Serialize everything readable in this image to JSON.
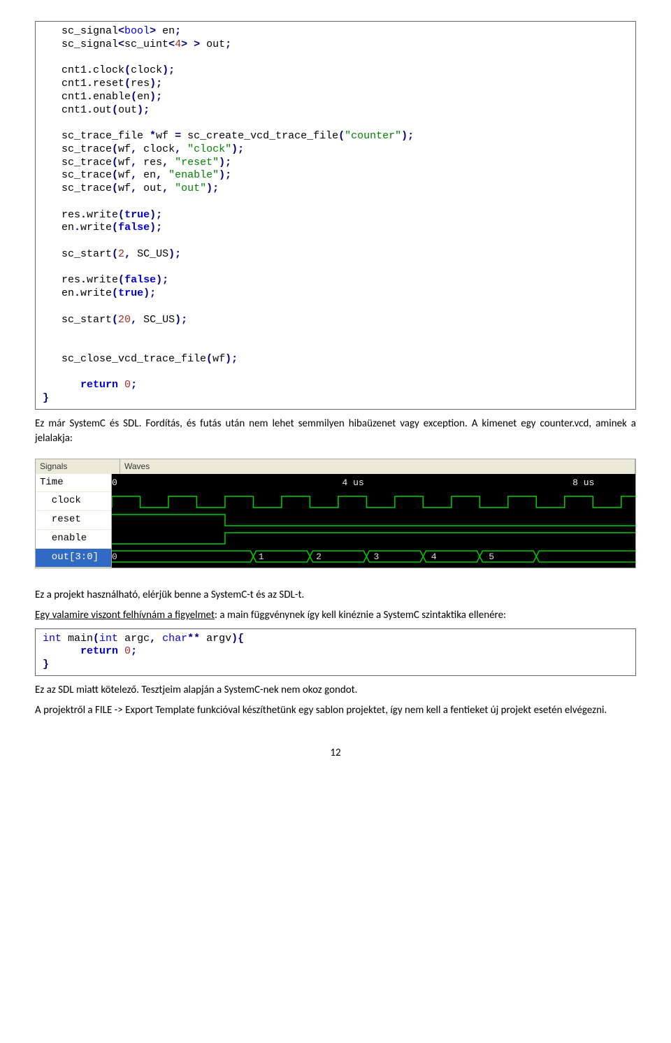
{
  "code1": {
    "lines": [
      [
        {
          "t": "sc_signal",
          "c": ""
        },
        {
          "t": "<",
          "c": "c-navy"
        },
        {
          "t": "bool",
          "c": "c-blue"
        },
        {
          "t": ">",
          "c": "c-navy"
        },
        {
          "t": " en",
          "c": ""
        },
        {
          "t": ";",
          "c": "c-navy"
        }
      ],
      [
        {
          "t": "sc_signal",
          "c": ""
        },
        {
          "t": "<",
          "c": "c-navy"
        },
        {
          "t": "sc_uint",
          "c": ""
        },
        {
          "t": "<",
          "c": "c-navy"
        },
        {
          "t": "4",
          "c": "c-brown"
        },
        {
          "t": ">",
          "c": "c-navy"
        },
        {
          "t": " ",
          "c": ""
        },
        {
          "t": ">",
          "c": "c-navy"
        },
        {
          "t": " out",
          "c": ""
        },
        {
          "t": ";",
          "c": "c-navy"
        }
      ],
      [],
      [
        {
          "t": "cnt1",
          "c": ""
        },
        {
          "t": ".",
          "c": "c-navy"
        },
        {
          "t": "clock",
          "c": ""
        },
        {
          "t": "(",
          "c": "c-navy"
        },
        {
          "t": "clock",
          "c": ""
        },
        {
          "t": ");",
          "c": "c-navy"
        }
      ],
      [
        {
          "t": "cnt1",
          "c": ""
        },
        {
          "t": ".",
          "c": "c-navy"
        },
        {
          "t": "reset",
          "c": ""
        },
        {
          "t": "(",
          "c": "c-navy"
        },
        {
          "t": "res",
          "c": ""
        },
        {
          "t": ");",
          "c": "c-navy"
        }
      ],
      [
        {
          "t": "cnt1",
          "c": ""
        },
        {
          "t": ".",
          "c": "c-navy"
        },
        {
          "t": "enable",
          "c": ""
        },
        {
          "t": "(",
          "c": "c-navy"
        },
        {
          "t": "en",
          "c": ""
        },
        {
          "t": ");",
          "c": "c-navy"
        }
      ],
      [
        {
          "t": "cnt1",
          "c": ""
        },
        {
          "t": ".",
          "c": "c-navy"
        },
        {
          "t": "out",
          "c": ""
        },
        {
          "t": "(",
          "c": "c-navy"
        },
        {
          "t": "out",
          "c": ""
        },
        {
          "t": ");",
          "c": "c-navy"
        }
      ],
      [],
      [
        {
          "t": "sc_trace_file ",
          "c": ""
        },
        {
          "t": "*",
          "c": "c-navy"
        },
        {
          "t": "wf ",
          "c": ""
        },
        {
          "t": "=",
          "c": "c-navy"
        },
        {
          "t": " sc_create_vcd_trace_file",
          "c": ""
        },
        {
          "t": "(",
          "c": "c-navy"
        },
        {
          "t": "\"counter\"",
          "c": "c-green"
        },
        {
          "t": ");",
          "c": "c-navy"
        }
      ],
      [
        {
          "t": "sc_trace",
          "c": ""
        },
        {
          "t": "(",
          "c": "c-navy"
        },
        {
          "t": "wf",
          "c": ""
        },
        {
          "t": ",",
          "c": "c-navy"
        },
        {
          "t": " clock",
          "c": ""
        },
        {
          "t": ",",
          "c": "c-navy"
        },
        {
          "t": " ",
          "c": ""
        },
        {
          "t": "\"clock\"",
          "c": "c-green"
        },
        {
          "t": ");",
          "c": "c-navy"
        }
      ],
      [
        {
          "t": "sc_trace",
          "c": ""
        },
        {
          "t": "(",
          "c": "c-navy"
        },
        {
          "t": "wf",
          "c": ""
        },
        {
          "t": ",",
          "c": "c-navy"
        },
        {
          "t": " res",
          "c": ""
        },
        {
          "t": ",",
          "c": "c-navy"
        },
        {
          "t": " ",
          "c": ""
        },
        {
          "t": "\"reset\"",
          "c": "c-green"
        },
        {
          "t": ");",
          "c": "c-navy"
        }
      ],
      [
        {
          "t": "sc_trace",
          "c": ""
        },
        {
          "t": "(",
          "c": "c-navy"
        },
        {
          "t": "wf",
          "c": ""
        },
        {
          "t": ",",
          "c": "c-navy"
        },
        {
          "t": " en",
          "c": ""
        },
        {
          "t": ",",
          "c": "c-navy"
        },
        {
          "t": " ",
          "c": ""
        },
        {
          "t": "\"enable\"",
          "c": "c-green"
        },
        {
          "t": ");",
          "c": "c-navy"
        }
      ],
      [
        {
          "t": "sc_trace",
          "c": ""
        },
        {
          "t": "(",
          "c": "c-navy"
        },
        {
          "t": "wf",
          "c": ""
        },
        {
          "t": ",",
          "c": "c-navy"
        },
        {
          "t": " out",
          "c": ""
        },
        {
          "t": ",",
          "c": "c-navy"
        },
        {
          "t": " ",
          "c": ""
        },
        {
          "t": "\"out\"",
          "c": "c-green"
        },
        {
          "t": ");",
          "c": "c-navy"
        }
      ],
      [],
      [
        {
          "t": "res",
          "c": ""
        },
        {
          "t": ".",
          "c": "c-navy"
        },
        {
          "t": "write",
          "c": ""
        },
        {
          "t": "(",
          "c": "c-navy"
        },
        {
          "t": "true",
          "c": "c-kw"
        },
        {
          "t": ");",
          "c": "c-navy"
        }
      ],
      [
        {
          "t": "en",
          "c": ""
        },
        {
          "t": ".",
          "c": "c-navy"
        },
        {
          "t": "write",
          "c": ""
        },
        {
          "t": "(",
          "c": "c-navy"
        },
        {
          "t": "false",
          "c": "c-kw"
        },
        {
          "t": ");",
          "c": "c-navy"
        }
      ],
      [],
      [
        {
          "t": "sc_start",
          "c": ""
        },
        {
          "t": "(",
          "c": "c-navy"
        },
        {
          "t": "2",
          "c": "c-brown"
        },
        {
          "t": ",",
          "c": "c-navy"
        },
        {
          "t": " SC_US",
          "c": ""
        },
        {
          "t": ");",
          "c": "c-navy"
        }
      ],
      [],
      [
        {
          "t": "res",
          "c": ""
        },
        {
          "t": ".",
          "c": "c-navy"
        },
        {
          "t": "write",
          "c": ""
        },
        {
          "t": "(",
          "c": "c-navy"
        },
        {
          "t": "false",
          "c": "c-kw"
        },
        {
          "t": ");",
          "c": "c-navy"
        }
      ],
      [
        {
          "t": "en",
          "c": ""
        },
        {
          "t": ".",
          "c": "c-navy"
        },
        {
          "t": "write",
          "c": ""
        },
        {
          "t": "(",
          "c": "c-navy"
        },
        {
          "t": "true",
          "c": "c-kw"
        },
        {
          "t": ");",
          "c": "c-navy"
        }
      ],
      [],
      [
        {
          "t": "sc_start",
          "c": ""
        },
        {
          "t": "(",
          "c": "c-navy"
        },
        {
          "t": "20",
          "c": "c-brown"
        },
        {
          "t": ",",
          "c": "c-navy"
        },
        {
          "t": " SC_US",
          "c": ""
        },
        {
          "t": ");",
          "c": "c-navy"
        }
      ],
      [],
      [],
      [
        {
          "t": "sc_close_vcd_trace_file",
          "c": ""
        },
        {
          "t": "(",
          "c": "c-navy"
        },
        {
          "t": "wf",
          "c": ""
        },
        {
          "t": ");",
          "c": "c-navy"
        }
      ],
      [],
      [
        {
          "t": "return",
          "c": "c-kw",
          "indent": 1
        },
        {
          "t": " ",
          "c": ""
        },
        {
          "t": "0",
          "c": "c-brown"
        },
        {
          "t": ";",
          "c": "c-navy"
        }
      ],
      [
        {
          "t": "}",
          "c": "c-navy",
          "noindent": true
        }
      ]
    ]
  },
  "para1": "Ez már SystemC és SDL. Fordítás, és futás után nem lehet semmilyen hibaüzenet vagy exception. A kimenet egy counter.vcd, aminek a jelalakja:",
  "waveform": {
    "header": {
      "signals": "Signals",
      "waves": "Waves"
    },
    "signals": [
      "Time",
      "clock",
      "reset",
      "enable",
      "out[3:0]"
    ],
    "selected": 4,
    "timeTicks": [
      {
        "x": 0,
        "label": "0"
      },
      {
        "x": 44,
        "label": "4 us"
      },
      {
        "x": 88,
        "label": "8 us"
      }
    ],
    "busValues": [
      {
        "x": 0,
        "label": "0"
      },
      {
        "x": 28,
        "label": "1"
      },
      {
        "x": 39,
        "label": "2"
      },
      {
        "x": 50,
        "label": "3"
      },
      {
        "x": 61,
        "label": "4"
      },
      {
        "x": 72,
        "label": "5"
      }
    ]
  },
  "para2": "Ez a projekt használható, elérjük benne a SystemC-t és az SDL-t.",
  "para3_u": "Egy valamire viszont felhívnám a figyelmet",
  "para3_rest": ": a main függvénynek így kell kinéznie a SystemC szintaktika ellenére:",
  "code2": {
    "lines": [
      [
        {
          "t": "int",
          "c": "c-blue",
          "noindent": true
        },
        {
          "t": " main",
          "c": ""
        },
        {
          "t": "(",
          "c": "c-navy"
        },
        {
          "t": "int",
          "c": "c-blue"
        },
        {
          "t": " argc",
          "c": ""
        },
        {
          "t": ",",
          "c": "c-navy"
        },
        {
          "t": " ",
          "c": ""
        },
        {
          "t": "char",
          "c": "c-blue"
        },
        {
          "t": "**",
          "c": "c-navy"
        },
        {
          "t": " argv",
          "c": ""
        },
        {
          "t": "){",
          "c": "c-navy"
        }
      ],
      [
        {
          "t": "return",
          "c": "c-kw",
          "indent": 1
        },
        {
          "t": " ",
          "c": ""
        },
        {
          "t": "0",
          "c": "c-brown"
        },
        {
          "t": ";",
          "c": "c-navy"
        }
      ],
      [
        {
          "t": "}",
          "c": "c-navy",
          "noindent": true
        }
      ]
    ]
  },
  "para4": "Ez az SDL miatt kötelező. Tesztjeim alapján a SystemC-nek nem okoz gondot.",
  "para5": "A projektről a FILE -> Export Template funkcióval készíthetünk egy sablon projektet, így nem kell a fentieket új projekt esetén elvégezni.",
  "pagenum": "12"
}
